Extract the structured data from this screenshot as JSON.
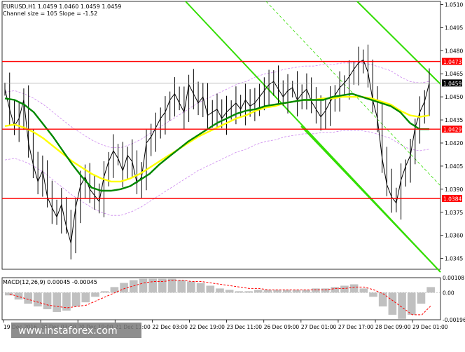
{
  "header": {
    "symbol_line": "EURUSD,H1  1.0459 1.0460 1.0459 1.0459",
    "channel_line": "Channel size = 105 Slope = -1.52"
  },
  "watermark": {
    "text": "www.instaforex.com"
  },
  "macd": {
    "label": "MACD(12,26,9) 0.00045 -0.00045",
    "ticks": [
      {
        "value": 0.00108,
        "label": "0.00108"
      },
      {
        "value": 0.0,
        "label": "0.00"
      },
      {
        "value": -0.00196,
        "label": "-0.00196"
      }
    ]
  },
  "colors": {
    "support_resistance": "#ff0000",
    "channel": "#33dd00",
    "ma_fast": "#008800",
    "ma_slow": "#ffff00",
    "envelope": "#cc88ee",
    "price": "#000000",
    "macd_hist": "#c0c0c0",
    "macd_signal": "#ff0000"
  },
  "chart_data": {
    "type": "candlestick",
    "y_ticks": [
      1.051,
      1.0495,
      1.048,
      1.0465,
      1.045,
      1.0435,
      1.042,
      1.0405,
      1.039,
      1.0375,
      1.036,
      1.0345
    ],
    "y_range": [
      1.0338,
      1.0512
    ],
    "x_labels": [
      "19 Dec 2016",
      "20 Dec 03:00",
      "20 Dec 19:00",
      "21 Dec 11:00",
      "22 Dec 03:00",
      "22 Dec 19:00",
      "23 Dec 11:00",
      "26 Dec 09:00",
      "27 Dec 01:00",
      "27 Dec 17:00",
      "28 Dec 09:00",
      "29 Dec 01:00"
    ],
    "current_price": {
      "value": 1.0459,
      "label": "1.0459"
    },
    "levels": [
      {
        "value": 1.0473,
        "label": "1.0473"
      },
      {
        "value": 1.0429,
        "label": "1.0429"
      },
      {
        "value": 1.0384,
        "label": "1.0384"
      }
    ],
    "series_close": [
      1.0455,
      1.0442,
      1.0431,
      1.0436,
      1.0448,
      1.042,
      1.0406,
      1.0395,
      1.0402,
      1.0385,
      1.0378,
      1.0372,
      1.038,
      1.0366,
      1.0355,
      1.0378,
      1.0392,
      1.0398,
      1.039,
      1.0386,
      1.0382,
      1.0398,
      1.0408,
      1.0415,
      1.041,
      1.0402,
      1.0412,
      1.0408,
      1.0394,
      1.0398,
      1.042,
      1.0424,
      1.043,
      1.0436,
      1.044,
      1.0448,
      1.0452,
      1.0446,
      1.044,
      1.0458,
      1.0452,
      1.0446,
      1.045,
      1.0438,
      1.044,
      1.0442,
      1.0436,
      1.044,
      1.0443,
      1.0446,
      1.0442,
      1.0448,
      1.0444,
      1.0446,
      1.045,
      1.0454,
      1.0458,
      1.046,
      1.0455,
      1.045,
      1.0454,
      1.0456,
      1.0448,
      1.0452,
      1.0455,
      1.0447,
      1.0442,
      1.0437,
      1.0441,
      1.0447,
      1.0451,
      1.0456,
      1.0459,
      1.0463,
      1.0468,
      1.0472,
      1.0474,
      1.0466,
      1.0448,
      1.0436,
      1.041,
      1.0393,
      1.0385,
      1.0381,
      1.0396,
      1.0405,
      1.0412,
      1.043,
      1.044,
      1.0447,
      1.0459
    ],
    "ma_fast": [
      1.0449,
      1.0448,
      1.0445,
      1.044,
      1.0432,
      1.0424,
      1.0415,
      1.0406,
      1.0398,
      1.0391,
      1.0389,
      1.0389,
      1.039,
      1.0392,
      1.0396,
      1.04,
      1.0406,
      1.0411,
      1.0416,
      1.0421,
      1.0425,
      1.0429,
      1.0433,
      1.0436,
      1.0439,
      1.0441,
      1.0442,
      1.0444,
      1.0445,
      1.0446,
      1.0447,
      1.0448,
      1.0448,
      1.0448,
      1.045,
      1.0451,
      1.0452,
      1.045,
      1.0448,
      1.0446,
      1.0444,
      1.044,
      1.0433,
      1.0429,
      1.0429
    ],
    "ma_slow": [
      1.0431,
      1.0432,
      1.043,
      1.0427,
      1.0423,
      1.0418,
      1.0413,
      1.0408,
      1.0404,
      1.04,
      1.0397,
      1.0395,
      1.0395,
      1.0397,
      1.04,
      1.0404,
      1.0408,
      1.0412,
      1.0416,
      1.042,
      1.0424,
      1.0427,
      1.043,
      1.0433,
      1.0436,
      1.0438,
      1.0441,
      1.0443,
      1.0444,
      1.0446,
      1.0447,
      1.0448,
      1.0448,
      1.0449,
      1.0449,
      1.045,
      1.045,
      1.045,
      1.0449,
      1.0447,
      1.0445,
      1.0441,
      1.0438,
      1.0437,
      1.0438
    ],
    "macd_hist": [
      -0.0002,
      -0.0005,
      -0.0008,
      -0.001,
      -0.0012,
      -0.0014,
      -0.0013,
      -0.001,
      -0.0007,
      -0.0003,
      0.0001,
      0.0004,
      0.0007,
      0.0009,
      0.001,
      0.001,
      0.001,
      0.001,
      0.0009,
      0.0008,
      0.0007,
      0.0005,
      0.0003,
      0.0002,
      0.0001,
      0.0001,
      0.0002,
      0.0002,
      0.0002,
      0.0002,
      0.0002,
      0.0002,
      0.0003,
      0.0003,
      0.0004,
      0.0005,
      0.0006,
      0.0003,
      -0.0003,
      -0.001,
      -0.0016,
      -0.0019,
      -0.0016,
      -0.0008,
      0.0004
    ],
    "macd_signal": [
      -0.0001,
      -0.0003,
      -0.0005,
      -0.0007,
      -0.0009,
      -0.001,
      -0.0011,
      -0.001,
      -0.0009,
      -0.0006,
      -0.0003,
      0.0,
      0.0003,
      0.0005,
      0.0007,
      0.0008,
      0.0008,
      0.0009,
      0.0009,
      0.0008,
      0.0008,
      0.0007,
      0.0006,
      0.0005,
      0.0004,
      0.0003,
      0.0003,
      0.0002,
      0.0002,
      0.0002,
      0.0002,
      0.0002,
      0.0002,
      0.0002,
      0.0003,
      0.0003,
      0.0004,
      0.0004,
      0.0002,
      -0.0001,
      -0.0006,
      -0.0011,
      -0.0016,
      -0.0016,
      -0.0009
    ]
  }
}
